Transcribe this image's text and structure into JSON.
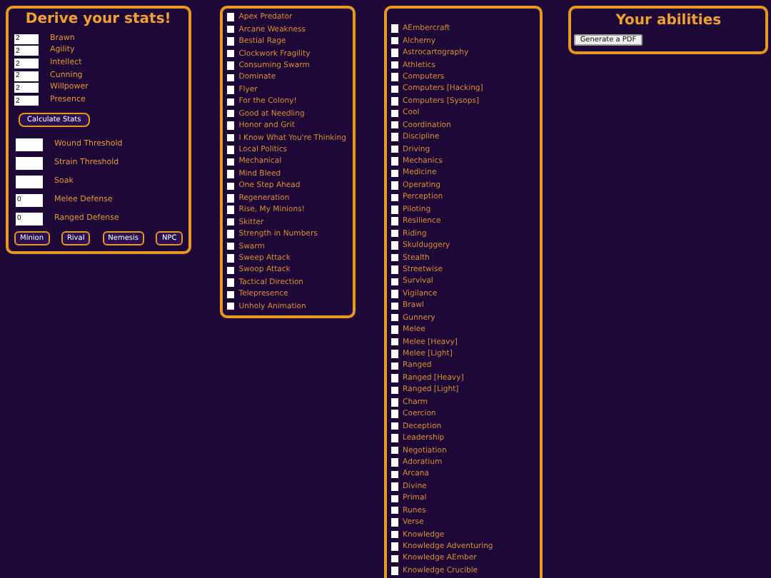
{
  "stats_panel": {
    "title": "Derive your stats!",
    "characteristics": [
      {
        "value": "2",
        "label": "Brawn"
      },
      {
        "value": "2",
        "label": "Agility"
      },
      {
        "value": "2",
        "label": "Intellect"
      },
      {
        "value": "2",
        "label": "Cunning"
      },
      {
        "value": "2",
        "label": "Willpower"
      },
      {
        "value": "2",
        "label": "Presence"
      }
    ],
    "calculate_button": "Calculate Stats",
    "derived": [
      {
        "label": "Wound Threshold"
      },
      {
        "label": "Strain Threshold"
      },
      {
        "label": "Soak"
      },
      {
        "value": "0",
        "label": "Melee Defense"
      },
      {
        "value": "0",
        "label": "Ranged Defense"
      }
    ],
    "buttons": [
      "Minion",
      "Rival",
      "Nemesis",
      "NPC"
    ]
  },
  "talents": [
    {
      "label": "Apex Predator",
      "checked": false
    },
    {
      "label": "Arcane Weakness",
      "checked": false
    },
    {
      "label": "Bestial Rage",
      "checked": false
    },
    {
      "label": "Clockwork Fragility",
      "checked": false
    },
    {
      "label": "Consuming Swarm",
      "checked": false
    },
    {
      "label": "Dominate",
      "checked": false
    },
    {
      "label": "Flyer",
      "checked": false
    },
    {
      "label": "For the Colony!",
      "checked": false
    },
    {
      "label": "Good at Needling",
      "checked": false
    },
    {
      "label": "Honor and Grit",
      "checked": false
    },
    {
      "label": "I Know What You're Thinking",
      "checked": false
    },
    {
      "label": "Local Politics",
      "checked": false
    },
    {
      "label": "Mechanical",
      "checked": false
    },
    {
      "label": "Mind Bleed",
      "checked": false
    },
    {
      "label": "One Step Ahead",
      "checked": false
    },
    {
      "label": "Regeneration",
      "checked": false
    },
    {
      "label": "Rise, My Minions!",
      "checked": false
    },
    {
      "label": "Skitter",
      "checked": false
    },
    {
      "label": "Strength in Numbers",
      "checked": false
    },
    {
      "label": "Swarm",
      "checked": false
    },
    {
      "label": "Sweep Attack",
      "checked": false
    },
    {
      "label": "Swoop Attack",
      "checked": false
    },
    {
      "label": "Tactical Direction",
      "checked": false
    },
    {
      "label": "Telepresence",
      "checked": false
    },
    {
      "label": "Unholy Animation",
      "checked": false
    }
  ],
  "skills": [
    {
      "label": "AEmbercraft",
      "checked": false
    },
    {
      "label": "Alchemy",
      "checked": false
    },
    {
      "label": "Astrocartography",
      "checked": false
    },
    {
      "label": "Athletics",
      "checked": false
    },
    {
      "label": "Computers",
      "checked": false
    },
    {
      "label": "Computers [Hacking]",
      "checked": false
    },
    {
      "label": "Computers [Sysops]",
      "checked": false
    },
    {
      "label": "Cool",
      "checked": false
    },
    {
      "label": "Coordination",
      "checked": false
    },
    {
      "label": "Discipline",
      "checked": false
    },
    {
      "label": "Driving",
      "checked": false
    },
    {
      "label": "Mechanics",
      "checked": false
    },
    {
      "label": "Medicine",
      "checked": false
    },
    {
      "label": "Operating",
      "checked": false
    },
    {
      "label": "Perception",
      "checked": false
    },
    {
      "label": "Piloting",
      "checked": false
    },
    {
      "label": "Resilience",
      "checked": false
    },
    {
      "label": "Riding",
      "checked": false
    },
    {
      "label": "Skulduggery",
      "checked": false
    },
    {
      "label": "Stealth",
      "checked": false
    },
    {
      "label": "Streetwise",
      "checked": false
    },
    {
      "label": "Survival",
      "checked": false
    },
    {
      "label": "Vigilance",
      "checked": false
    },
    {
      "label": "Brawl",
      "checked": false
    },
    {
      "label": "Gunnery",
      "checked": false
    },
    {
      "label": "Melee",
      "checked": false
    },
    {
      "label": "Melee [Heavy]",
      "checked": false
    },
    {
      "label": "Melee [Light]",
      "checked": false
    },
    {
      "label": "Ranged",
      "checked": false
    },
    {
      "label": "Ranged [Heavy]",
      "checked": false
    },
    {
      "label": "Ranged [Light]",
      "checked": false
    },
    {
      "label": "Charm",
      "checked": false
    },
    {
      "label": "Coercion",
      "checked": false
    },
    {
      "label": "Deception",
      "checked": false
    },
    {
      "label": "Leadership",
      "checked": false
    },
    {
      "label": "Negotiation",
      "checked": false
    },
    {
      "label": "Adoratium",
      "checked": false
    },
    {
      "label": "Arcana",
      "checked": false
    },
    {
      "label": "Divine",
      "checked": false
    },
    {
      "label": "Primal",
      "checked": false
    },
    {
      "label": "Runes",
      "checked": false
    },
    {
      "label": "Verse",
      "checked": false
    },
    {
      "label": "Knowledge",
      "checked": false
    },
    {
      "label": "Knowledge Adventuring",
      "checked": false
    },
    {
      "label": "Knowledge AEmber",
      "checked": false
    },
    {
      "label": "Knowledge Crucible",
      "checked": false
    }
  ],
  "abilities_panel": {
    "title": "Your abilities",
    "button": "Generate a PDF"
  }
}
